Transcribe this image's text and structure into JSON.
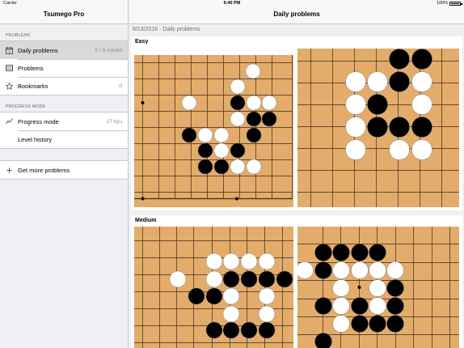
{
  "status_bar": {
    "carrier": "Carrier",
    "time": "6:40 PM",
    "battery": "100%"
  },
  "sidebar": {
    "title": "Tsumego Pro",
    "sections": [
      {
        "header": "PROBLEMS",
        "items": [
          {
            "icon": "calendar-icon",
            "label": "Daily problems",
            "detail": "0 / 6 solved",
            "selected": true
          },
          {
            "icon": "list-icon",
            "label": "Problems",
            "detail": ""
          },
          {
            "icon": "star-icon",
            "label": "Bookmarks",
            "detail": "0"
          }
        ]
      },
      {
        "header": "PROGRESS MODE",
        "items": [
          {
            "icon": "graph-icon",
            "label": "Progress mode",
            "detail": "17 kyu"
          },
          {
            "icon": "",
            "label": "Level history",
            "detail": ""
          }
        ]
      },
      {
        "header": "",
        "items": [
          {
            "icon": "plus-icon",
            "label": "Get more problems",
            "detail": ""
          }
        ]
      }
    ]
  },
  "main": {
    "title": "Daily problems",
    "date_line": "8/13/2016 · Daily problems",
    "cards": [
      {
        "title": "Easy"
      },
      {
        "title": "Medium"
      }
    ]
  },
  "colors": {
    "board": "#e3ac6b",
    "grid": "#3b2a1a",
    "sidebar_bg": "#efeff4",
    "selected_row": "#d9d9d9"
  }
}
